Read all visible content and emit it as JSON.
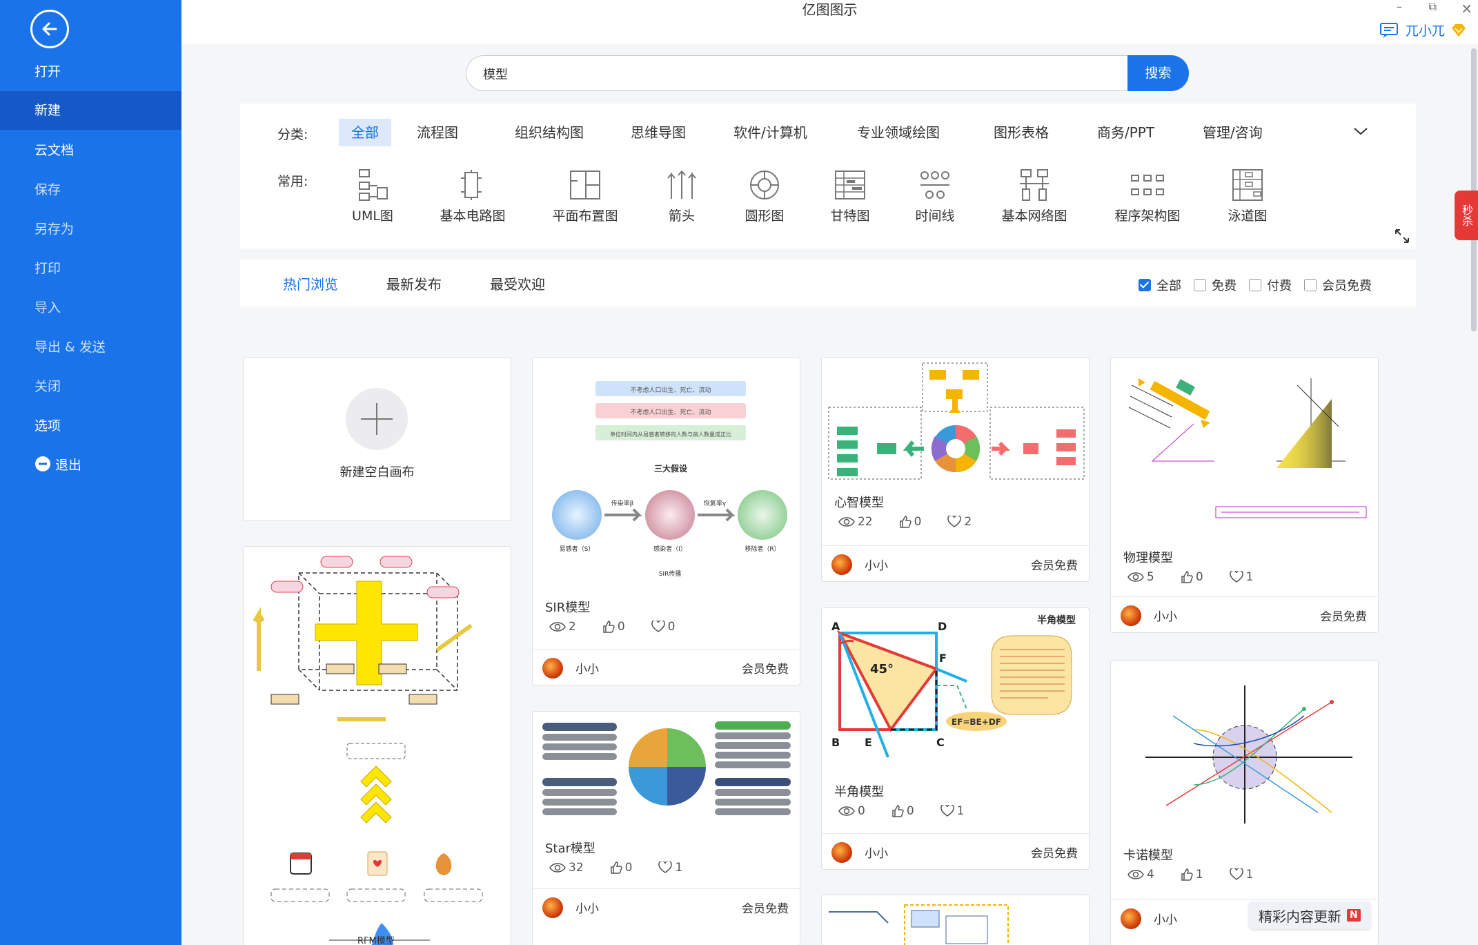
{
  "window": {
    "title": "亿图图示",
    "min": "–",
    "restore": "⧉",
    "close": "×"
  },
  "user": {
    "name": "兀小兀"
  },
  "sidebar": {
    "items": [
      {
        "label": "打开"
      },
      {
        "label": "新建"
      },
      {
        "label": "云文档"
      },
      {
        "label": "保存"
      },
      {
        "label": "另存为"
      },
      {
        "label": "打印"
      },
      {
        "label": "导入"
      },
      {
        "label": "导出 & 发送"
      },
      {
        "label": "关闭"
      },
      {
        "label": "选项"
      },
      {
        "label": "退出"
      }
    ]
  },
  "search": {
    "value": "模型",
    "button": "搜索"
  },
  "categories": {
    "label": "分类:",
    "tabs": [
      "全部",
      "流程图",
      "组织结构图",
      "思维导图",
      "软件/计算机",
      "专业领域绘图",
      "图形表格",
      "商务/PPT",
      "管理/咨询"
    ]
  },
  "common": {
    "label": "常用:",
    "items": [
      "UML图",
      "基本电路图",
      "平面布置图",
      "箭头",
      "圆形图",
      "甘特图",
      "时间线",
      "基本网络图",
      "程序架构图",
      "泳道图"
    ]
  },
  "sort": {
    "tabs": [
      "热门浏览",
      "最新发布",
      "最受欢迎"
    ],
    "filters": [
      {
        "label": "全部",
        "checked": true
      },
      {
        "label": "免费",
        "checked": false
      },
      {
        "label": "付费",
        "checked": false
      },
      {
        "label": "会员免费",
        "checked": false
      }
    ]
  },
  "new_blank": {
    "label": "新建空白画布"
  },
  "cards": [
    {
      "title": "SIR模型",
      "views": "2",
      "likes": "0",
      "favs": "0",
      "author": "小小",
      "tier": "会员免费",
      "thumb": {
        "box1": "不考虑人口出生、死亡、流动",
        "box2": "不考虑人口出生、死亡、流动",
        "box3": "单位时间内从易感者转移的人数与病人数量成正比",
        "heading": "三大假设",
        "s": "易感者（S）",
        "i": "感染者（I）",
        "r": "移除者（R）",
        "arrow1": "传染率β",
        "arrow2": "恢复率γ",
        "foot": "SIR传播"
      }
    },
    {
      "title": "Star模型",
      "views": "32",
      "likes": "0",
      "favs": "1",
      "author": "小小",
      "tier": "会员免费"
    },
    {
      "title": "心智模型",
      "views": "22",
      "likes": "0",
      "favs": "2",
      "author": "小小",
      "tier": "会员免费"
    },
    {
      "title": "半角模型",
      "views": "0",
      "likes": "0",
      "favs": "1",
      "author": "小小",
      "tier": "会员免费",
      "thumb": {
        "a": "A",
        "b": "B",
        "c": "C",
        "d": "D",
        "e": "E",
        "f": "F",
        "angle": "45°",
        "heading": "半角模型",
        "formula": "EF=BE+DF"
      }
    },
    {
      "title": "物理模型",
      "views": "5",
      "likes": "0",
      "favs": "1",
      "author": "小小",
      "tier": "会员免费"
    },
    {
      "title": "卡诺模型",
      "views": "4",
      "likes": "1",
      "favs": "1",
      "author": "小小",
      "tier": ""
    }
  ],
  "rfm_card": {
    "label": "RFM模型"
  },
  "promo": {
    "text": "精彩内容更新",
    "badge": "N"
  },
  "sale_tab": {
    "text": "秒杀"
  },
  "colors": {
    "brand": "#1a73e8",
    "sidebar_active": "#1558c8"
  }
}
